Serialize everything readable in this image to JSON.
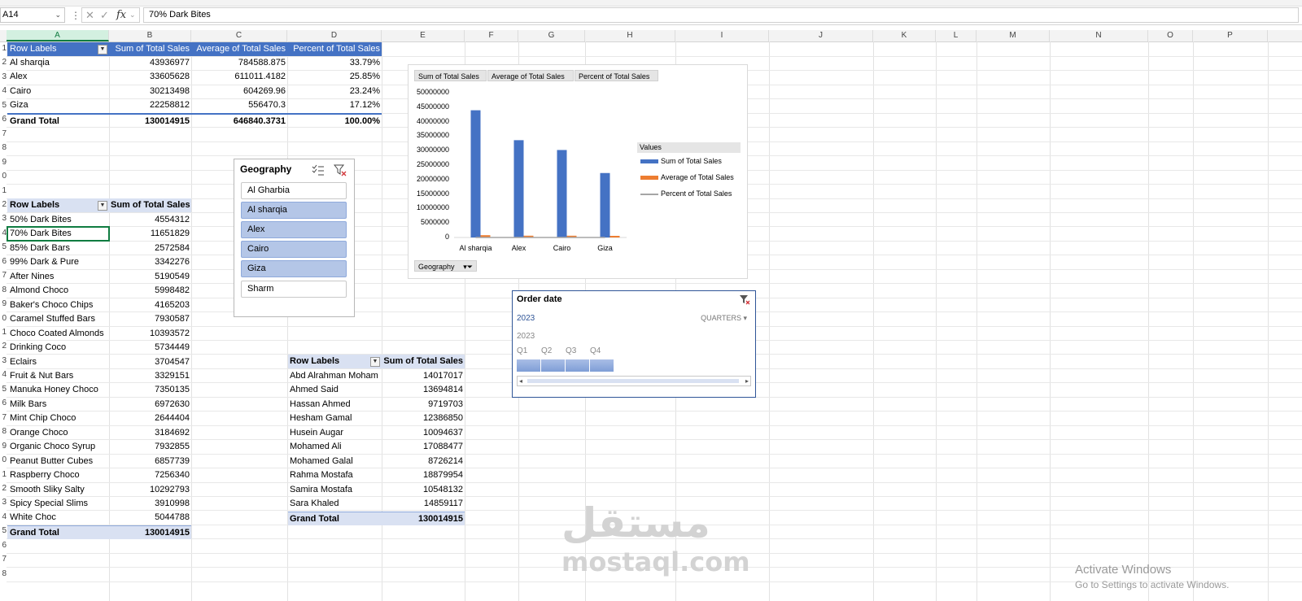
{
  "formula_bar": {
    "name_box": "A14",
    "value": "70% Dark Bites",
    "cancel_glyph": "✕",
    "enter_glyph": "✓",
    "fx_glyph": "fx"
  },
  "columns": [
    "A",
    "B",
    "C",
    "D",
    "E",
    "F",
    "G",
    "H",
    "I",
    "J",
    "K",
    "L",
    "M",
    "N",
    "O",
    "P"
  ],
  "active_column": "A",
  "row_numbers": [
    "1",
    "2",
    "3",
    "4",
    "5",
    "6",
    "7",
    "8",
    "9",
    "0",
    "1",
    "2",
    "3",
    "4",
    "5",
    "6",
    "7",
    "8",
    "9",
    "0",
    "1",
    "2",
    "3",
    "4",
    "5",
    "6",
    "7",
    "8",
    "9",
    "0",
    "1",
    "2",
    "3",
    "4",
    "5",
    "6",
    "7",
    "8"
  ],
  "pivot_geo": {
    "headers": [
      "Row Labels",
      "Sum of Total Sales",
      "Average of Total Sales",
      "Percent of Total Sales"
    ],
    "rows": [
      {
        "label": "Al sharqia",
        "sum": "43936977",
        "avg": "784588.875",
        "pct": "33.79%"
      },
      {
        "label": "Alex",
        "sum": "33605628",
        "avg": "611011.4182",
        "pct": "25.85%"
      },
      {
        "label": "Cairo",
        "sum": "30213498",
        "avg": "604269.96",
        "pct": "23.24%"
      },
      {
        "label": "Giza",
        "sum": "22258812",
        "avg": "556470.3",
        "pct": "17.12%"
      }
    ],
    "total": {
      "label": "Grand Total",
      "sum": "130014915",
      "avg": "646840.3731",
      "pct": "100.00%"
    }
  },
  "pivot_product": {
    "headers": [
      "Row Labels",
      "Sum of Total Sales"
    ],
    "rows": [
      {
        "label": "50% Dark Bites",
        "sum": "4554312"
      },
      {
        "label": "70% Dark Bites",
        "sum": "11651829"
      },
      {
        "label": "85% Dark Bars",
        "sum": "2572584"
      },
      {
        "label": "99% Dark & Pure",
        "sum": "3342276"
      },
      {
        "label": "After Nines",
        "sum": "5190549"
      },
      {
        "label": "Almond Choco",
        "sum": "5998482"
      },
      {
        "label": "Baker's Choco Chips",
        "sum": "4165203"
      },
      {
        "label": "Caramel Stuffed Bars",
        "sum": "7930587"
      },
      {
        "label": "Choco Coated Almonds",
        "sum": "10393572"
      },
      {
        "label": "Drinking Coco",
        "sum": "5734449"
      },
      {
        "label": "Eclairs",
        "sum": "3704547"
      },
      {
        "label": "Fruit & Nut Bars",
        "sum": "3329151"
      },
      {
        "label": "Manuka Honey Choco",
        "sum": "7350135"
      },
      {
        "label": "Milk Bars",
        "sum": "6972630"
      },
      {
        "label": "Mint Chip Choco",
        "sum": "2644404"
      },
      {
        "label": "Orange Choco",
        "sum": "3184692"
      },
      {
        "label": "Organic Choco Syrup",
        "sum": "7932855"
      },
      {
        "label": "Peanut Butter Cubes",
        "sum": "6857739"
      },
      {
        "label": "Raspberry Choco",
        "sum": "7256340"
      },
      {
        "label": "Smooth Sliky Salty",
        "sum": "10292793"
      },
      {
        "label": "Spicy Special Slims",
        "sum": "3910998"
      },
      {
        "label": "White Choc",
        "sum": "5044788"
      }
    ],
    "total": {
      "label": "Grand Total",
      "sum": "130014915"
    }
  },
  "pivot_salesperson": {
    "headers": [
      "Row Labels",
      "Sum of Total Sales"
    ],
    "rows": [
      {
        "label": "Abd Alrahman Moham",
        "sum": "14017017"
      },
      {
        "label": "Ahmed Said",
        "sum": "13694814"
      },
      {
        "label": "Hassan Ahmed",
        "sum": "9719703"
      },
      {
        "label": "Hesham Gamal",
        "sum": "12386850"
      },
      {
        "label": "Husein Augar",
        "sum": "10094637"
      },
      {
        "label": "Mohamed Ali",
        "sum": "17088477"
      },
      {
        "label": "Mohamed Galal",
        "sum": "8726214"
      },
      {
        "label": "Rahma Mostafa",
        "sum": "18879954"
      },
      {
        "label": "Samira Mostafa",
        "sum": "10548132"
      },
      {
        "label": "Sara Khaled",
        "sum": "14859117"
      }
    ],
    "total": {
      "label": "Grand Total",
      "sum": "130014915"
    }
  },
  "slicer_geography": {
    "title": "Geography",
    "items": [
      {
        "label": "Al Gharbia",
        "selected": false
      },
      {
        "label": "Al sharqia",
        "selected": true
      },
      {
        "label": "Alex",
        "selected": true
      },
      {
        "label": "Cairo",
        "selected": true
      },
      {
        "label": "Giza",
        "selected": true
      },
      {
        "label": "Sharm",
        "selected": false
      }
    ]
  },
  "timeline": {
    "title": "Order date",
    "selected_label": "2023",
    "level": "QUARTERS",
    "year": "2023",
    "quarters": [
      "Q1",
      "Q2",
      "Q3",
      "Q4"
    ],
    "selected_quarters": 4
  },
  "chart_data": {
    "type": "bar",
    "field_buttons": [
      "Sum of Total Sales",
      "Average of Total Sales",
      "Percent of Total Sales"
    ],
    "axis_field_button": "Geography",
    "legend_title": "Values",
    "categories": [
      "Al sharqia",
      "Alex",
      "Cairo",
      "Giza"
    ],
    "series": [
      {
        "name": "Sum of Total Sales",
        "values": [
          43936977,
          33605628,
          30213498,
          22258812
        ],
        "color": "#4472c4"
      },
      {
        "name": "Average of Total Sales",
        "values": [
          784588.875,
          611011.4182,
          604269.96,
          556470.3
        ],
        "color": "#ed7d31"
      },
      {
        "name": "Percent of Total Sales",
        "values": [
          0.3379,
          0.2585,
          0.2324,
          0.1712
        ],
        "color": "#a5a5a5"
      }
    ],
    "ylim": [
      0,
      50000000
    ],
    "yticks": [
      "50000000",
      "45000000",
      "40000000",
      "35000000",
      "30000000",
      "25000000",
      "20000000",
      "15000000",
      "10000000",
      "5000000",
      "0"
    ],
    "legend_position": "right"
  },
  "watermark": {
    "arabic": "مستقل",
    "latin": "mostaql.com"
  },
  "activate_windows": {
    "title": "Activate Windows",
    "subtitle": "Go to Settings to activate Windows."
  }
}
